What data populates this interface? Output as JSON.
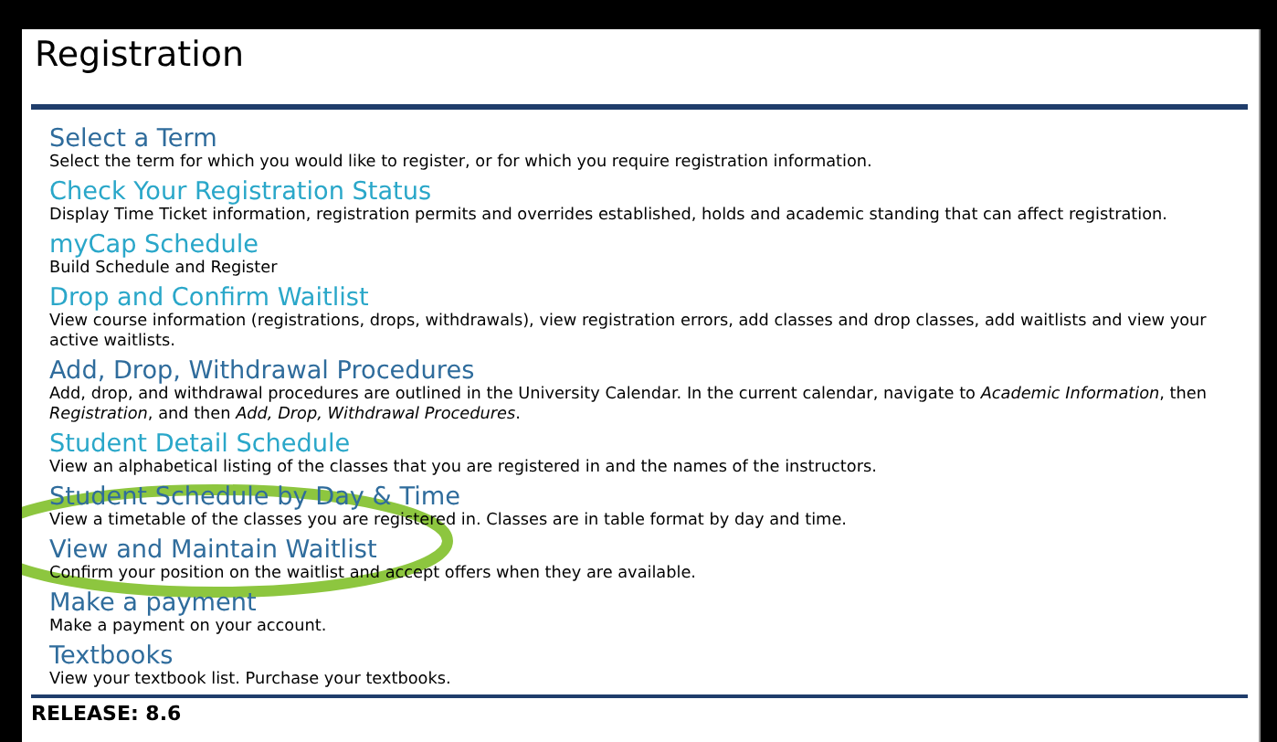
{
  "page": {
    "title": "Registration"
  },
  "items": [
    {
      "title": "Select a Term",
      "visited": true,
      "highlighted": false,
      "description": "Select the term for which you would like to register, or for which you require registration information."
    },
    {
      "title": "Check Your Registration Status",
      "visited": false,
      "highlighted": false,
      "description": "Display Time Ticket information, registration permits and overrides established, holds and academic standing that can affect registration."
    },
    {
      "title": "myCap Schedule",
      "visited": false,
      "highlighted": false,
      "description": "Build Schedule and Register"
    },
    {
      "title": "Drop and Confirm Waitlist",
      "visited": false,
      "highlighted": false,
      "description": "View course information (registrations, drops, withdrawals), view registration errors, add classes and drop classes, add waitlists and view your active waitlists."
    },
    {
      "title": "Add, Drop, Withdrawal Procedures",
      "visited": true,
      "highlighted": false,
      "description": "Add, drop, and withdrawal procedures are outlined in the University Calendar. In the current calendar, navigate to *Academic Information*, then *Registration*, and then *Add, Drop, Withdrawal Procedures*."
    },
    {
      "title": "Student Detail Schedule",
      "visited": false,
      "highlighted": false,
      "description": "View an alphabetical listing of the classes that you are registered in and the names of the instructors."
    },
    {
      "title": "Student Schedule by Day & Time",
      "visited": true,
      "highlighted": false,
      "description": "View a timetable of the classes you are registered in. Classes are in table format by day and time."
    },
    {
      "title": "View and Maintain Waitlist",
      "visited": true,
      "highlighted": true,
      "description": "Confirm your position on the waitlist and accept offers when they are available."
    },
    {
      "title": "Make a payment",
      "visited": true,
      "highlighted": false,
      "description": "Make a payment on your account."
    },
    {
      "title": "Textbooks",
      "visited": true,
      "highlighted": false,
      "description": "View your textbook list. Purchase your textbooks."
    }
  ],
  "footer": {
    "release": "RELEASE: 8.6"
  }
}
